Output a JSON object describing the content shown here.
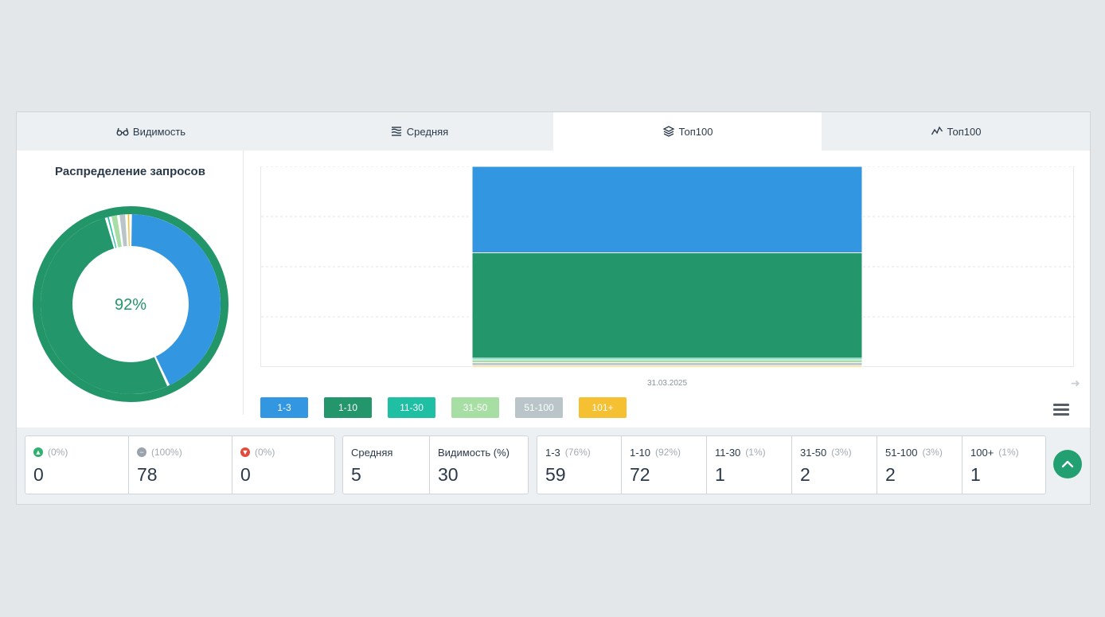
{
  "tabs": [
    {
      "label": "Видимость",
      "icon": "glasses-icon",
      "active": false
    },
    {
      "label": "Средняя",
      "icon": "lines-icon",
      "active": false
    },
    {
      "label": "Топ100",
      "icon": "layers-icon",
      "active": true
    },
    {
      "label": "Топ100",
      "icon": "line-chart-icon",
      "active": false
    }
  ],
  "donut": {
    "title": "Распределение запросов",
    "center_label": "92%",
    "ring_color": "#239669"
  },
  "chart_data": {
    "type": "bar",
    "stacked": true,
    "categories": [
      "31.03.2025"
    ],
    "series": [
      {
        "name": "1-3",
        "values": [
          59
        ],
        "color": "#3396e0"
      },
      {
        "name": "1-10",
        "values": [
          72
        ],
        "color": "#23966b"
      },
      {
        "name": "11-30",
        "values": [
          1
        ],
        "color": "#1fbfa3"
      },
      {
        "name": "31-50",
        "values": [
          2
        ],
        "color": "#a6dea3"
      },
      {
        "name": "51-100",
        "values": [
          2
        ],
        "color": "#b9c5c8"
      },
      {
        "name": "101+",
        "values": [
          1
        ],
        "color": "#f5c132"
      }
    ],
    "grid": true,
    "legend_position": "bottom-left"
  },
  "chart_xlabel": "31.03.2025",
  "legend": [
    {
      "label": "1-3",
      "color": "#3396e0"
    },
    {
      "label": "1-10",
      "color": "#23966b"
    },
    {
      "label": "11-30",
      "color": "#1fbfa3"
    },
    {
      "label": "31-50",
      "color": "#a6dea3"
    },
    {
      "label": "51-100",
      "color": "#b9c5c8"
    },
    {
      "label": "101+",
      "color": "#f5c132"
    }
  ],
  "stats": {
    "changes": [
      {
        "pct": "(0%)",
        "value": "0",
        "icon": "arrow-up-icon",
        "color": "#2fb26e"
      },
      {
        "pct": "(100%)",
        "value": "78",
        "icon": "minus-icon",
        "color": "#9aa3ab"
      },
      {
        "pct": "(0%)",
        "value": "0",
        "icon": "arrow-down-icon",
        "color": "#e04b3c"
      }
    ],
    "averages": [
      {
        "label": "Средняя",
        "value": "5"
      },
      {
        "label": "Видимость (%)",
        "value": "30"
      }
    ],
    "ranges": [
      {
        "label": "1-3",
        "pct": "(76%)",
        "value": "59"
      },
      {
        "label": "1-10",
        "pct": "(92%)",
        "value": "72"
      },
      {
        "label": "11-30",
        "pct": "(1%)",
        "value": "1"
      },
      {
        "label": "31-50",
        "pct": "(3%)",
        "value": "2"
      },
      {
        "label": "51-100",
        "pct": "(3%)",
        "value": "2"
      },
      {
        "label": "100+",
        "pct": "(1%)",
        "value": "1"
      }
    ]
  }
}
